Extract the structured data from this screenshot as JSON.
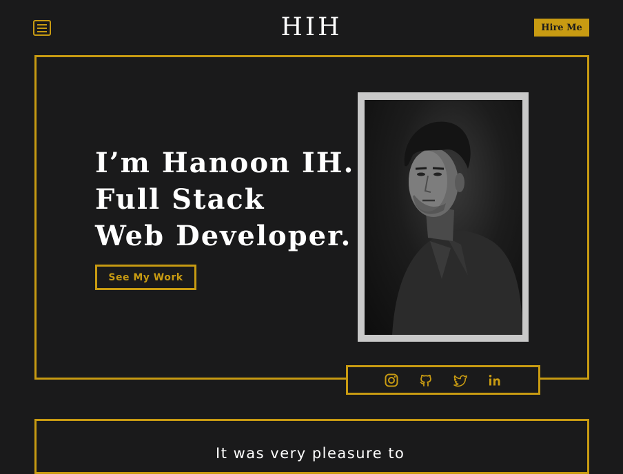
{
  "header": {
    "logo": "HIH",
    "hire_label": "Hire Me",
    "menu_icon": "hamburger-menu-icon"
  },
  "hero": {
    "title_lines": [
      "I’m Hanoon IH.",
      "Full Stack",
      "Web Developer."
    ],
    "cta_label": "See My Work",
    "photo_alt": "portrait"
  },
  "social": {
    "icons": [
      "instagram-icon",
      "github-icon",
      "twitter-icon",
      "linkedin-icon"
    ]
  },
  "about": {
    "intro": "It was very pleasure to"
  },
  "colors": {
    "background": "#1a1a1b",
    "accent": "#c89b12",
    "text": "#ffffff",
    "photo_border": "#c9c9c9"
  }
}
